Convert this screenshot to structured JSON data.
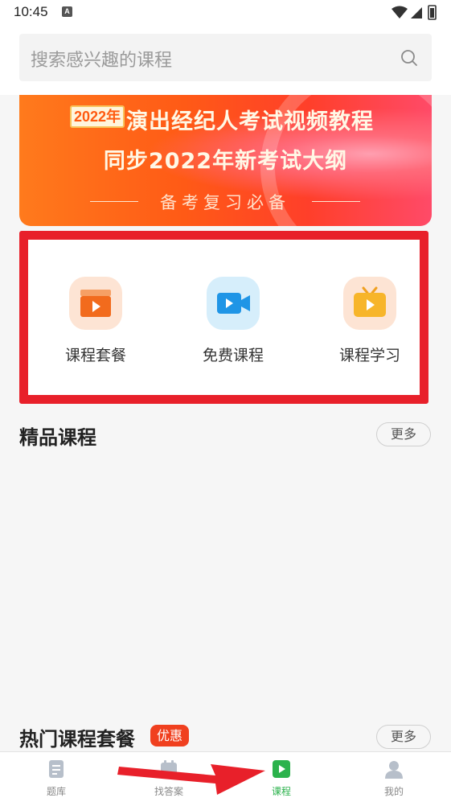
{
  "status_bar": {
    "time": "10:45",
    "notif": "A"
  },
  "search": {
    "placeholder": "搜索感兴趣的课程"
  },
  "banner": {
    "badge": "2022年",
    "title_line1": "演出经纪人考试视频教程",
    "title_line2": "同步2022年新考试大纲",
    "subtitle": "备考复习必备"
  },
  "entries": [
    {
      "label": "课程套餐",
      "icon": "course-package-icon"
    },
    {
      "label": "免费课程",
      "icon": "free-course-video-icon"
    },
    {
      "label": "课程学习",
      "icon": "course-study-tv-icon"
    }
  ],
  "featured": {
    "title": "精品课程",
    "more": "更多"
  },
  "hot": {
    "title": "热门课程套餐",
    "badge": "优惠",
    "more": "更多"
  },
  "tabs": [
    {
      "label": "题库",
      "icon": "question-bank-icon"
    },
    {
      "label": "找答案",
      "icon": "find-answer-icon"
    },
    {
      "label": "课程",
      "icon": "course-play-icon",
      "active": true
    },
    {
      "label": "我的",
      "icon": "profile-icon"
    }
  ],
  "colors": {
    "accent": "#2bb24c",
    "highlight_box": "#e8202a",
    "promo": "#f0401f"
  }
}
